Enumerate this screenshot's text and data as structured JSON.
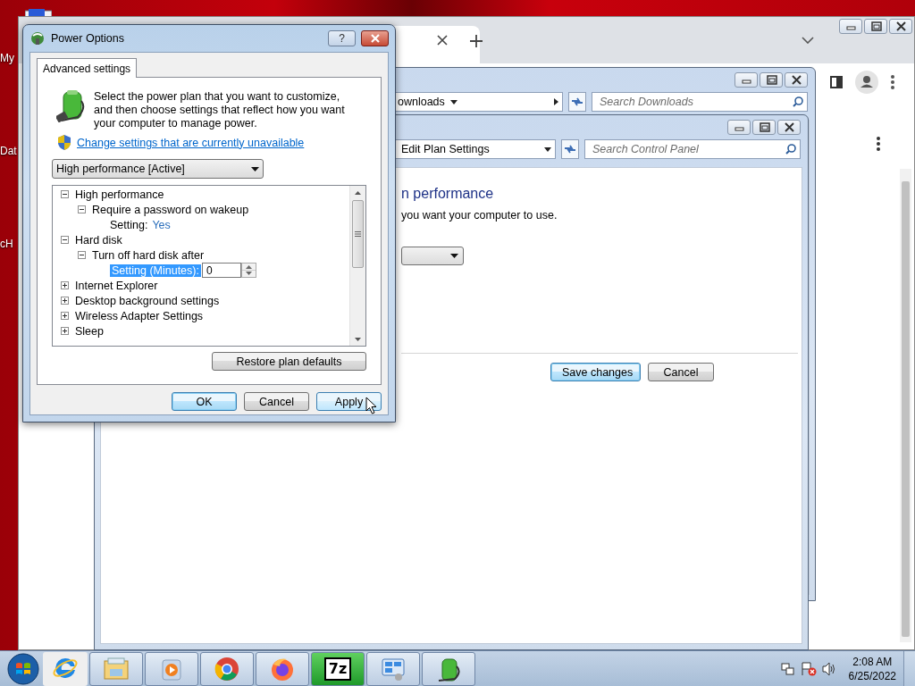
{
  "desktop": {
    "icons": [
      {
        "label": "My"
      },
      {
        "label": "Dat"
      },
      {
        "label": "cH"
      }
    ]
  },
  "downloads_window": {
    "address": "ownloads",
    "search": {
      "placeholder": "Search Downloads"
    }
  },
  "plan_window": {
    "address": "Edit Plan Settings",
    "search": {
      "placeholder": "Search Control Panel"
    },
    "heading": "n performance",
    "description": "you want your computer to use.",
    "buttons": [
      {
        "label": "Save changes",
        "default": true
      },
      {
        "label": "Cancel",
        "default": false
      }
    ]
  },
  "dialog": {
    "title": "Power Options",
    "help": "?",
    "tabs": [
      {
        "label": "Advanced settings",
        "selected": true
      }
    ],
    "intro": "Select the power plan that you want to customize, and then choose settings that reflect how you want your computer to manage power.",
    "link": "Change settings that are currently unavailable",
    "plan_select": "High performance [Active]",
    "tree": [
      {
        "label": "High performance",
        "expanded": true,
        "children": [
          {
            "label": "Require a password on wakeup",
            "expanded": true,
            "children": [
              {
                "kind": "setting",
                "label": "Setting:",
                "value": "Yes",
                "selected": false
              }
            ]
          }
        ]
      },
      {
        "label": "Hard disk",
        "expanded": true,
        "children": [
          {
            "label": "Turn off hard disk after",
            "expanded": true,
            "children": [
              {
                "kind": "spin",
                "label": "Setting (Minutes):",
                "value": "0",
                "selected": true
              }
            ]
          }
        ]
      },
      {
        "label": "Internet Explorer",
        "expanded": false
      },
      {
        "label": "Desktop background settings",
        "expanded": false
      },
      {
        "label": "Wireless Adapter Settings",
        "expanded": false
      },
      {
        "label": "Sleep",
        "expanded": false
      }
    ],
    "restore_button": "Restore plan defaults",
    "buttons": [
      {
        "label": "OK",
        "default": true,
        "hover": false
      },
      {
        "label": "Cancel",
        "default": false,
        "hover": false
      },
      {
        "label": "Apply",
        "default": false,
        "hover": true
      }
    ]
  },
  "taskbar": {
    "apps": [
      {
        "kind": "ie",
        "running": false
      },
      {
        "kind": "explorer",
        "running": true
      },
      {
        "kind": "media",
        "running": true
      },
      {
        "kind": "chrome",
        "running": true
      },
      {
        "kind": "firefox",
        "running": true
      },
      {
        "kind": "archiver",
        "label": "7z",
        "running": true
      },
      {
        "kind": "control",
        "running": true
      },
      {
        "kind": "power",
        "running": true
      }
    ],
    "clock": {
      "time": "2:08 AM",
      "date": "6/25/2022"
    }
  }
}
